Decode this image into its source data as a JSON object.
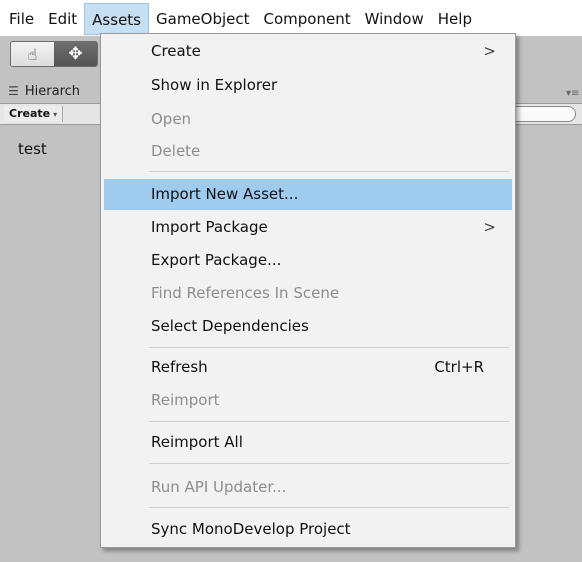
{
  "menubar": {
    "items": [
      {
        "label": "File"
      },
      {
        "label": "Edit"
      },
      {
        "label": "Assets"
      },
      {
        "label": "GameObject"
      },
      {
        "label": "Component"
      },
      {
        "label": "Window"
      },
      {
        "label": "Help"
      }
    ]
  },
  "toolbar": {
    "tools": [
      {
        "icon": "hand-icon",
        "glyph": "☝"
      },
      {
        "icon": "move-icon",
        "glyph": "✥"
      }
    ]
  },
  "hierarchy": {
    "tab_icon": "☰",
    "tab_label": "Hierarch",
    "create_label": "Create",
    "create_arrow": "▾",
    "panel_menu_glyph": "▾≡",
    "items": [
      {
        "label": "test"
      }
    ]
  },
  "assets_menu": {
    "items": [
      {
        "label": "Create",
        "submenu_arrow": ">"
      },
      {
        "label": "Show in Explorer"
      },
      {
        "label": "Open"
      },
      {
        "label": "Delete"
      },
      {
        "label": "Import New Asset..."
      },
      {
        "label": "Import Package",
        "submenu_arrow": ">"
      },
      {
        "label": "Export Package..."
      },
      {
        "label": "Find References In Scene"
      },
      {
        "label": "Select Dependencies"
      },
      {
        "label": "Refresh",
        "shortcut": "Ctrl+R"
      },
      {
        "label": "Reimport"
      },
      {
        "label": "Reimport All"
      },
      {
        "label": "Run API Updater..."
      },
      {
        "label": "Sync MonoDevelop Project"
      }
    ]
  }
}
